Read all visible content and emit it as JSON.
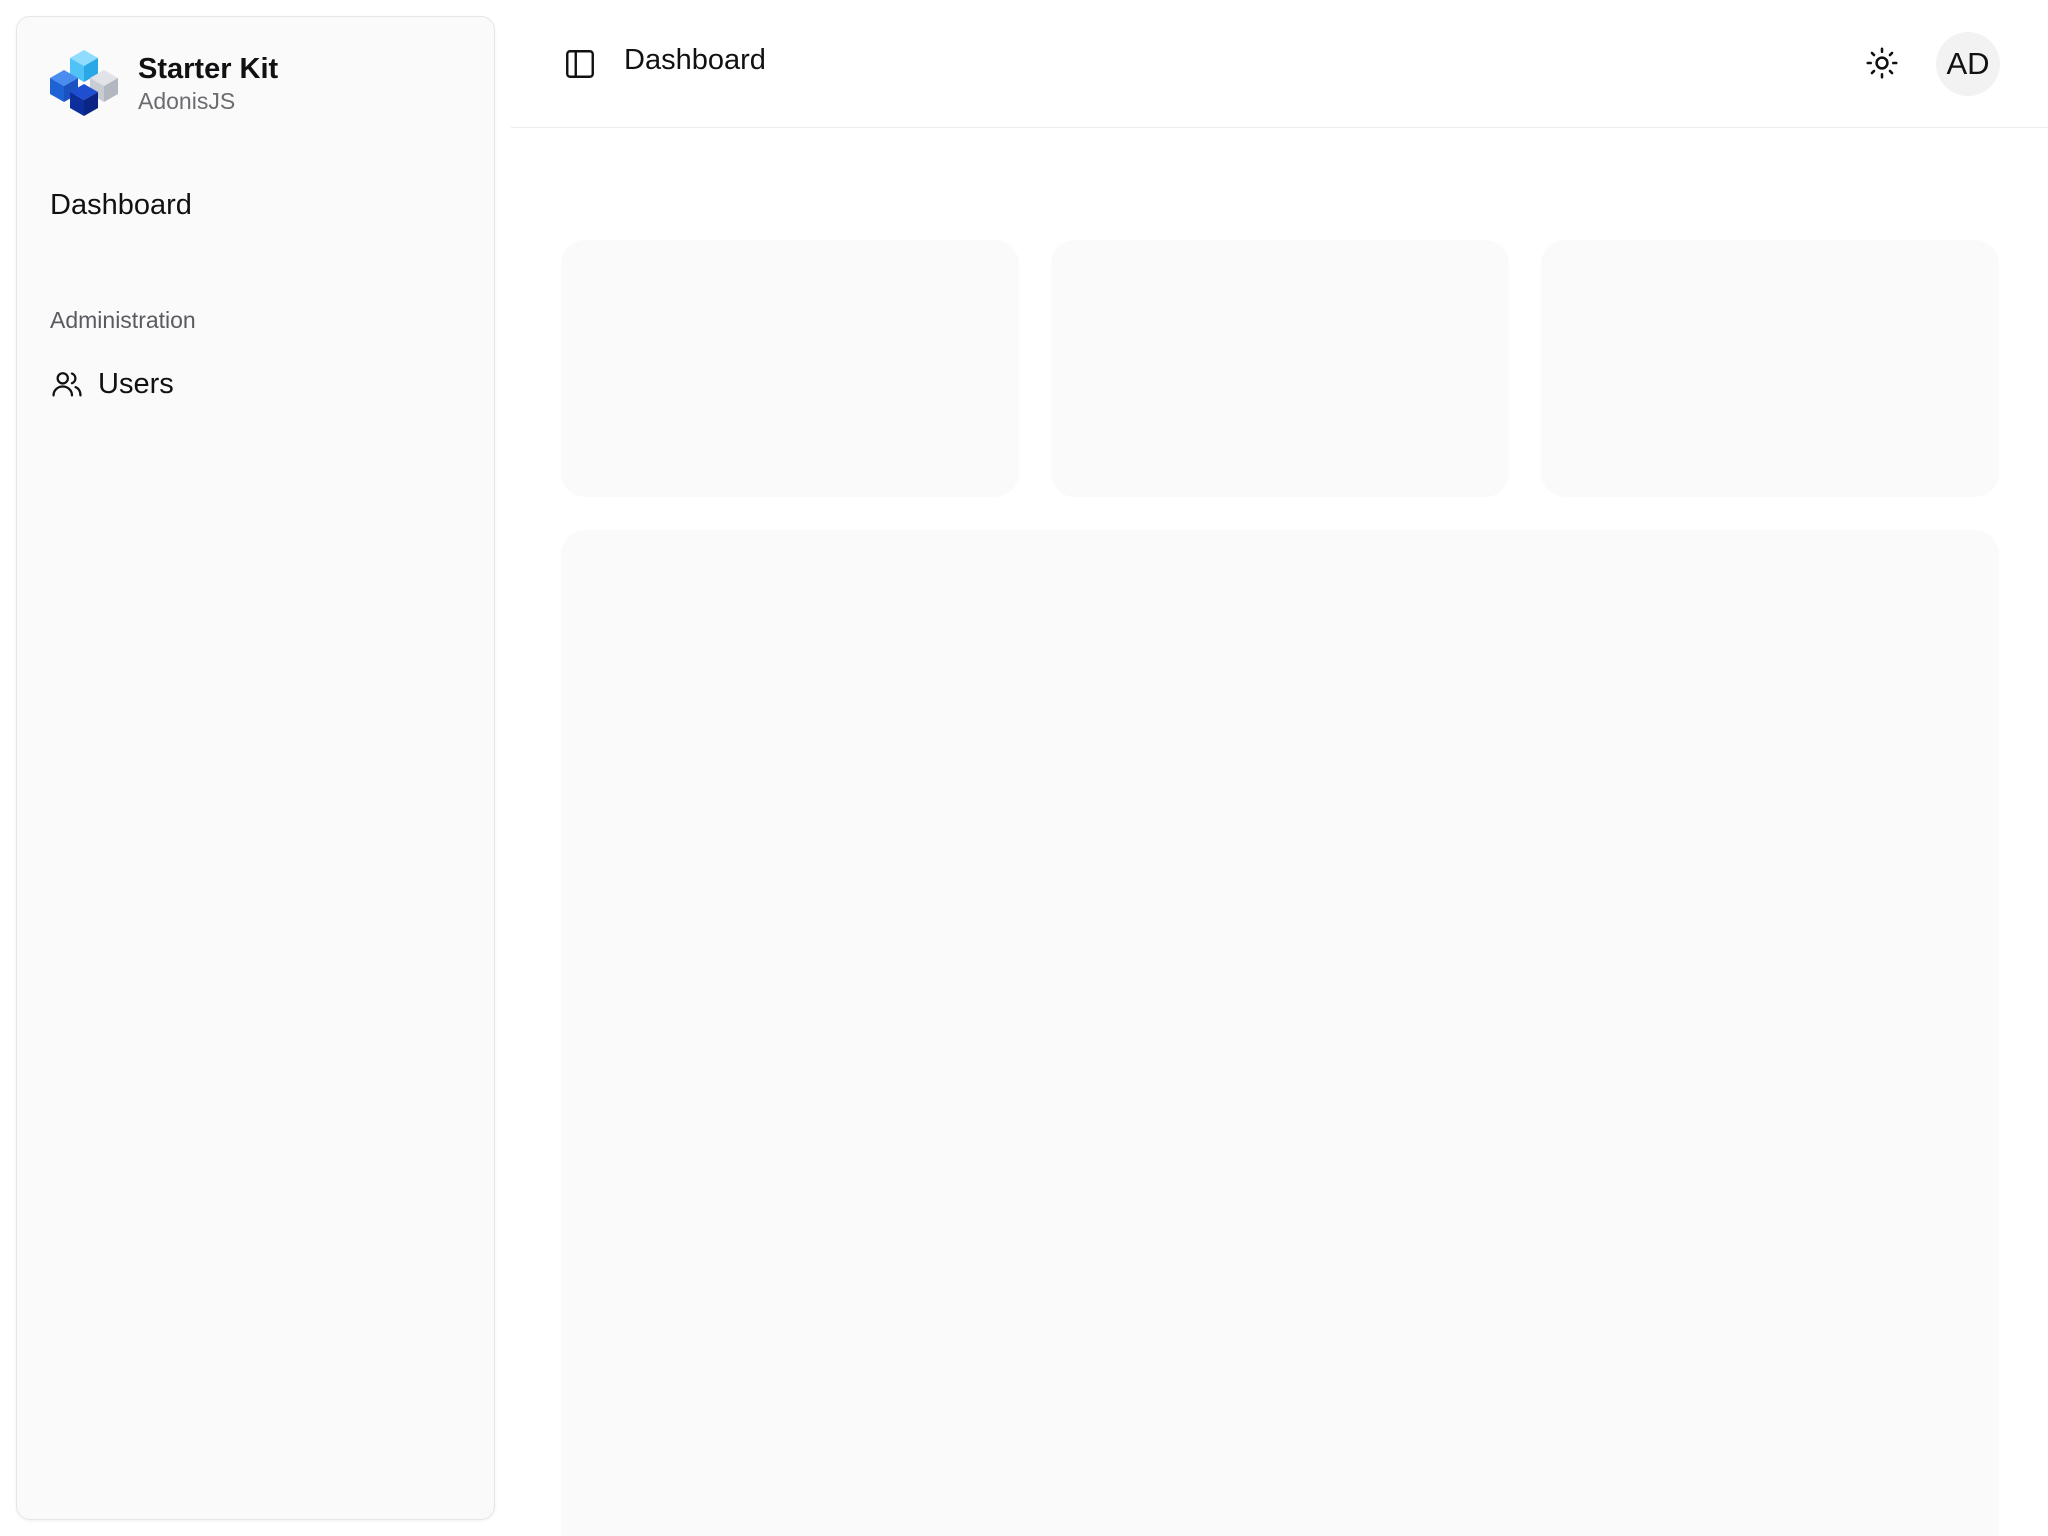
{
  "brand": {
    "title": "Starter Kit",
    "subtitle": "AdonisJS",
    "logo_icon": "cubes-logo-icon"
  },
  "sidebar": {
    "items": [
      {
        "label": "Dashboard",
        "icon": null
      },
      {
        "label": "Users",
        "icon": "users-icon"
      }
    ],
    "section_label": "Administration"
  },
  "topbar": {
    "title": "Dashboard",
    "toggle_icon": "sidebar-toggle-icon",
    "theme_icon": "sun-icon",
    "avatar_initials": "AD"
  },
  "colors": {
    "logo_light_blue": "#4fc3f7",
    "logo_blue": "#1e63d6",
    "logo_dark_blue": "#0d2f9e",
    "logo_grey": "#c9ccd3",
    "skeleton": "#fafafa",
    "sidebar_bg": "#fafafa"
  }
}
